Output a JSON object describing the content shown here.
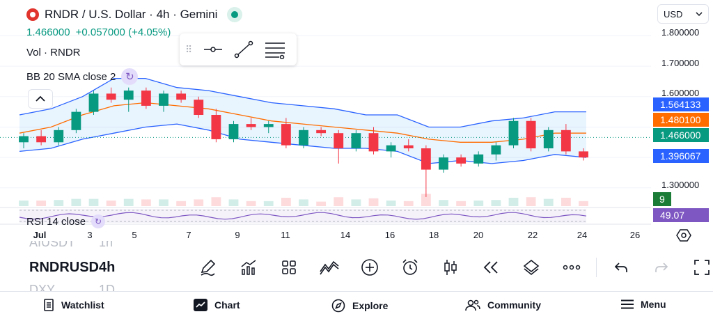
{
  "header": {
    "symbol_title": "RNDR / U.S. Dollar · 4h · Gemini",
    "price": "1.466000",
    "change": "+0.057000 (+4.05%)",
    "vol_label": "Vol · RNDR",
    "bb_label": "BB 20 SMA close 2",
    "rsi_label": "RSI 14 close"
  },
  "currency": {
    "selected": "USD"
  },
  "price_axis": {
    "labels": [
      "1.800000",
      "1.700000",
      "1.600000",
      "1.300000"
    ],
    "badges": {
      "bb_upper": "1.564133",
      "bb_basis": "1.480100",
      "last_price": "1.466000",
      "bb_lower": "1.396067",
      "volume": "9",
      "rsi": "49.07"
    }
  },
  "time_axis": {
    "labels": [
      "Jul",
      "3",
      "5",
      "7",
      "9",
      "11",
      "14",
      "16",
      "18",
      "20",
      "22",
      "24",
      "26"
    ]
  },
  "symbols_list": [
    {
      "symbol": "AIUSDT",
      "interval": "1h"
    },
    {
      "symbol": "RNDRUSD",
      "interval": "4h"
    },
    {
      "symbol": "DXY",
      "interval": "1D"
    }
  ],
  "nav": {
    "watchlist": "Watchlist",
    "chart": "Chart",
    "explore": "Explore",
    "community": "Community",
    "menu": "Menu"
  },
  "colors": {
    "up": "#089981",
    "down": "#f23645",
    "bb_band": "#2962ff",
    "bb_basis": "#ff6d00",
    "rsi": "#7e57c2",
    "last_price": "#089981",
    "volume_badge": "#1b7c37"
  },
  "chart_data": {
    "type": "candlestick",
    "price_range": [
      1.24,
      1.84
    ],
    "bb_upper": [
      1.54,
      1.56,
      1.6,
      1.66,
      1.66,
      1.63,
      1.62,
      1.6,
      1.58,
      1.57,
      1.56,
      1.54,
      1.54,
      1.5,
      1.5,
      1.52,
      1.53,
      1.55,
      1.55
    ],
    "bb_basis": [
      1.48,
      1.5,
      1.54,
      1.57,
      1.58,
      1.57,
      1.56,
      1.54,
      1.52,
      1.51,
      1.5,
      1.49,
      1.48,
      1.46,
      1.45,
      1.45,
      1.46,
      1.48,
      1.48
    ],
    "bb_lower": [
      1.42,
      1.43,
      1.46,
      1.48,
      1.5,
      1.51,
      1.49,
      1.46,
      1.45,
      1.44,
      1.43,
      1.43,
      1.42,
      1.38,
      1.39,
      1.38,
      1.39,
      1.41,
      1.4
    ],
    "candles": [
      {
        "o": 1.45,
        "h": 1.48,
        "l": 1.43,
        "c": 1.47
      },
      {
        "o": 1.47,
        "h": 1.49,
        "l": 1.44,
        "c": 1.45
      },
      {
        "o": 1.45,
        "h": 1.5,
        "l": 1.44,
        "c": 1.49
      },
      {
        "o": 1.49,
        "h": 1.56,
        "l": 1.48,
        "c": 1.55
      },
      {
        "o": 1.55,
        "h": 1.62,
        "l": 1.54,
        "c": 1.61
      },
      {
        "o": 1.61,
        "h": 1.63,
        "l": 1.58,
        "c": 1.59
      },
      {
        "o": 1.59,
        "h": 1.63,
        "l": 1.55,
        "c": 1.62
      },
      {
        "o": 1.62,
        "h": 1.63,
        "l": 1.56,
        "c": 1.57
      },
      {
        "o": 1.57,
        "h": 1.62,
        "l": 1.55,
        "c": 1.61
      },
      {
        "o": 1.61,
        "h": 1.62,
        "l": 1.58,
        "c": 1.59
      },
      {
        "o": 1.59,
        "h": 1.6,
        "l": 1.53,
        "c": 1.54
      },
      {
        "o": 1.54,
        "h": 1.56,
        "l": 1.45,
        "c": 1.46
      },
      {
        "o": 1.46,
        "h": 1.52,
        "l": 1.45,
        "c": 1.51
      },
      {
        "o": 1.51,
        "h": 1.53,
        "l": 1.49,
        "c": 1.5
      },
      {
        "o": 1.5,
        "h": 1.52,
        "l": 1.48,
        "c": 1.51
      },
      {
        "o": 1.51,
        "h": 1.53,
        "l": 1.43,
        "c": 1.44
      },
      {
        "o": 1.44,
        "h": 1.5,
        "l": 1.43,
        "c": 1.49
      },
      {
        "o": 1.49,
        "h": 1.5,
        "l": 1.47,
        "c": 1.48
      },
      {
        "o": 1.48,
        "h": 1.49,
        "l": 1.38,
        "c": 1.43
      },
      {
        "o": 1.43,
        "h": 1.49,
        "l": 1.42,
        "c": 1.48
      },
      {
        "o": 1.48,
        "h": 1.5,
        "l": 1.41,
        "c": 1.42
      },
      {
        "o": 1.42,
        "h": 1.45,
        "l": 1.4,
        "c": 1.44
      },
      {
        "o": 1.44,
        "h": 1.46,
        "l": 1.42,
        "c": 1.43
      },
      {
        "o": 1.43,
        "h": 1.44,
        "l": 1.27,
        "c": 1.36
      },
      {
        "o": 1.36,
        "h": 1.41,
        "l": 1.35,
        "c": 1.4
      },
      {
        "o": 1.4,
        "h": 1.41,
        "l": 1.37,
        "c": 1.38
      },
      {
        "o": 1.38,
        "h": 1.42,
        "l": 1.37,
        "c": 1.41
      },
      {
        "o": 1.41,
        "h": 1.45,
        "l": 1.39,
        "c": 1.44
      },
      {
        "o": 1.44,
        "h": 1.53,
        "l": 1.43,
        "c": 1.52
      },
      {
        "o": 1.52,
        "h": 1.53,
        "l": 1.42,
        "c": 1.43
      },
      {
        "o": 1.43,
        "h": 1.5,
        "l": 1.42,
        "c": 1.49
      },
      {
        "o": 1.49,
        "h": 1.51,
        "l": 1.41,
        "c": 1.42
      },
      {
        "o": 1.42,
        "h": 1.43,
        "l": 1.39,
        "c": 1.4
      }
    ],
    "rsi_value": 49.07
  }
}
